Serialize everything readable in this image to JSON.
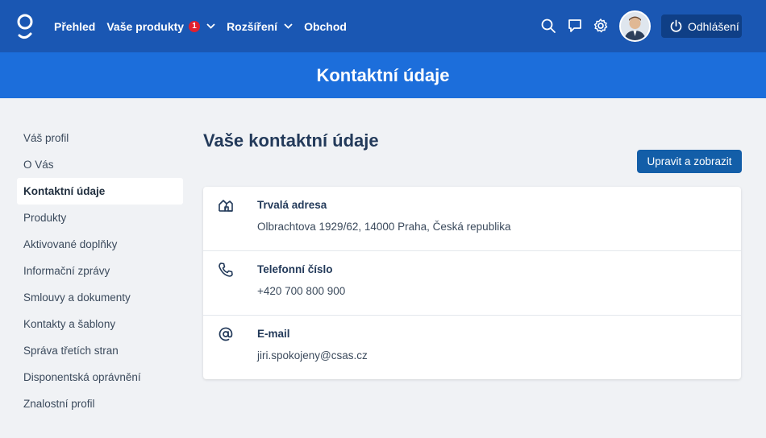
{
  "header": {
    "nav": [
      {
        "label": "Přehled"
      },
      {
        "label": "Vaše produkty",
        "badge": "1",
        "dropdown": true
      },
      {
        "label": "Rozšíření",
        "dropdown": true
      },
      {
        "label": "Obchod"
      }
    ],
    "icons": [
      "search-icon",
      "chat-icon",
      "gear-icon"
    ],
    "logout_label": "Odhlášení",
    "brand_color": "#1a57b3"
  },
  "hero": {
    "title": "Kontaktní údaje"
  },
  "sidebar": {
    "items": [
      {
        "label": "Váš profil"
      },
      {
        "label": "O Vás"
      },
      {
        "label": "Kontaktní údaje",
        "active": true
      },
      {
        "label": "Produkty"
      },
      {
        "label": "Aktivované doplňky"
      },
      {
        "label": "Informační zprávy"
      },
      {
        "label": "Smlouvy a dokumenty"
      },
      {
        "label": "Kontakty a šablony"
      },
      {
        "label": "Správa třetích stran"
      },
      {
        "label": "Disponentská oprávnění"
      },
      {
        "label": "Znalostní profil"
      }
    ]
  },
  "main": {
    "title": "Vaše kontaktní údaje",
    "edit_button": "Upravit a zobrazit",
    "rows": [
      {
        "icon": "home-icon",
        "label": "Trvalá adresa",
        "value": "Olbrachtova 1929/62, 14000 Praha, Česká republika"
      },
      {
        "icon": "phone-icon",
        "label": "Telefonní číslo",
        "value": "+420 700 800 900"
      },
      {
        "icon": "at-icon",
        "label": "E-mail",
        "value": "jiri.spokojeny@csas.cz"
      }
    ]
  }
}
